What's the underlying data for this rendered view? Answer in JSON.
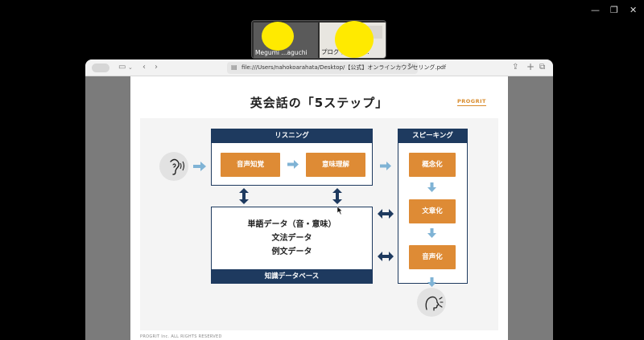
{
  "window": {
    "minimize": "—",
    "restore": "❐",
    "close": "✕"
  },
  "thumbnails": [
    {
      "label": "Megumi ...aguchi"
    },
    {
      "label": "プログリ...(ara..."
    }
  ],
  "toolbar": {
    "url": "file:///Users/nahokoarahata/Desktop/【公式】オンラインカウンセリング.pdf"
  },
  "slide": {
    "title": "英会話の「5ステップ」",
    "logo": "PROGRIT",
    "footer": "PROGRIT Inc. ALL RIGHTS RESERVED",
    "listening": {
      "header": "リスニング",
      "step1": "音声知覚",
      "step2": "意味理解"
    },
    "speaking": {
      "header": "スピーキング",
      "step3": "概念化",
      "step4": "文章化",
      "step5": "音声化"
    },
    "knowledge": {
      "line1": "単語データ（音・意味）",
      "line2": "文法データ",
      "line3": "例文データ",
      "footer": "知識データベース"
    }
  },
  "colors": {
    "navy": "#1e3a5f",
    "orange": "#de8b35",
    "arrow_light": "#7fb3d5",
    "highlight": "#ffea00"
  }
}
